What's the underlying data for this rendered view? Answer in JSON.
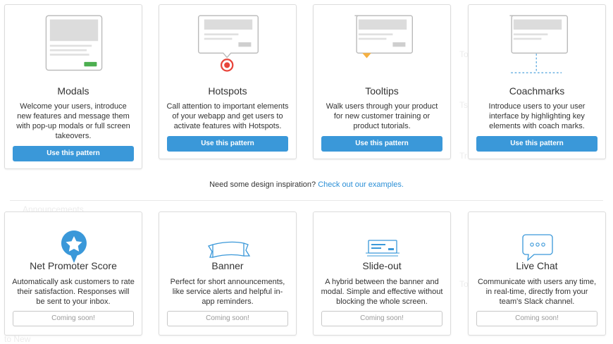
{
  "background_ghost": [
    "To",
    "Ts",
    "Tr",
    "To",
    "Announcements",
    "to New"
  ],
  "top_patterns": [
    {
      "title": "Modals",
      "description": "Welcome your users, introduce new features and message them with pop-up modals or full screen takeovers.",
      "button": "Use this pattern",
      "icon": "modal-illustration-icon"
    },
    {
      "title": "Hotspots",
      "description": "Call attention to important elements of your webapp and get users to activate features with Hotspots.",
      "button": "Use this pattern",
      "icon": "hotspot-illustration-icon"
    },
    {
      "title": "Tooltips",
      "description": "Walk users through your product for new customer training or product tutorials.",
      "button": "Use this pattern",
      "icon": "tooltip-illustration-icon"
    },
    {
      "title": "Coachmarks",
      "description": "Introduce users to your user interface by highlighting key elements with coach marks.",
      "button": "Use this pattern",
      "icon": "coachmark-illustration-icon"
    }
  ],
  "inspiration": {
    "text": "Need some design inspiration? ",
    "link": "Check out our examples."
  },
  "bottom_patterns": [
    {
      "title": "Net Promoter Score",
      "description": "Automatically ask customers to rate their satisfaction. Responses will be sent to your inbox.",
      "button": "Coming soon!",
      "icon": "star-badge-icon"
    },
    {
      "title": "Banner",
      "description": "Perfect for short announcements, like service alerts and helpful in-app reminders.",
      "button": "Coming soon!",
      "icon": "ribbon-banner-icon"
    },
    {
      "title": "Slide-out",
      "description": "A hybrid between the banner and modal. Simple and effective without blocking the whole screen.",
      "button": "Coming soon!",
      "icon": "slide-out-icon"
    },
    {
      "title": "Live Chat",
      "description": "Communicate with users any time, in real-time, directly from your team's Slack channel.",
      "button": "Coming soon!",
      "icon": "chat-bubble-icon"
    }
  ],
  "colors": {
    "primary_button": "#3a98d9",
    "link": "#2b8fd6",
    "hotspot": "#e8443a",
    "tooltip_arrow": "#f5b041",
    "modal_cta": "#4caf50",
    "coachmark_line": "#3a98d9",
    "icon_blue": "#3a98d9"
  }
}
